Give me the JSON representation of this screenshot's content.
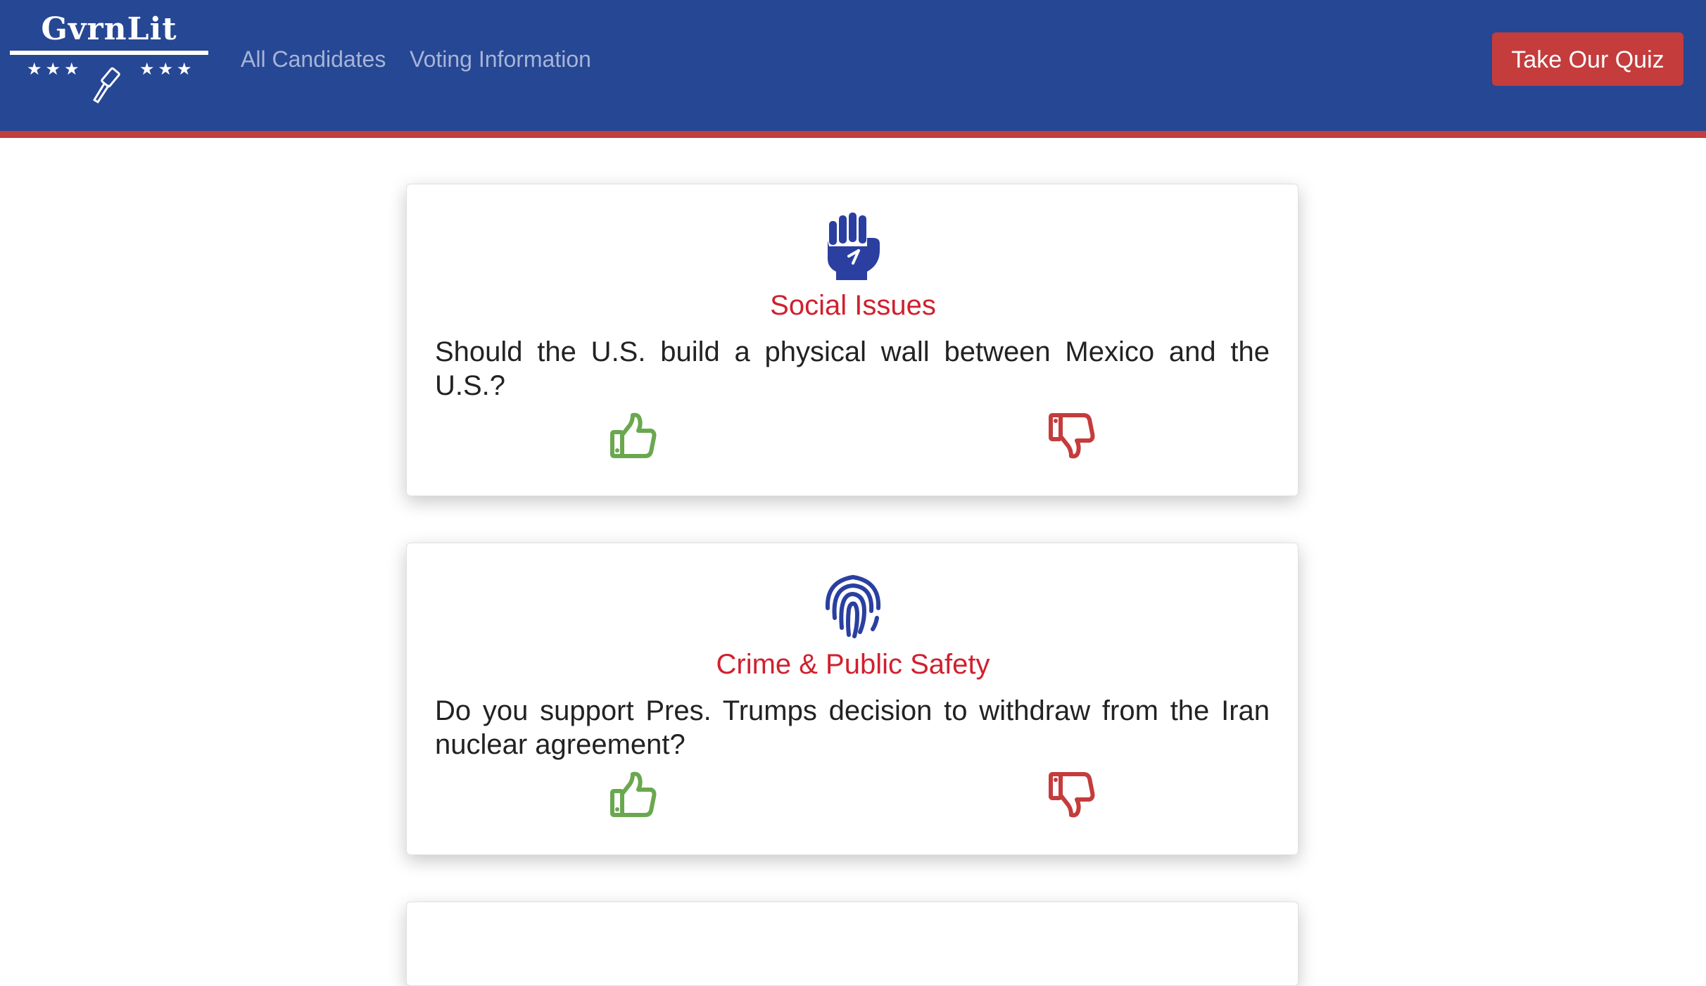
{
  "header": {
    "brand_name": "GvrnLit",
    "brand_stars_left": "★★★",
    "brand_stars_right": "★★★",
    "nav": [
      {
        "label": "All Candidates"
      },
      {
        "label": "Voting Information"
      }
    ],
    "quiz_button_label": "Take Our Quiz",
    "colors": {
      "navbar": "#264793",
      "accent": "#c43c3c",
      "nav_link": "#a6b4d8"
    }
  },
  "cards": [
    {
      "icon": "raised-fist-icon",
      "topic": "Social Issues",
      "question": "Should the U.S. build a physical wall between Mexico and the U.S.?",
      "agree_icon": "thumbs-up-icon",
      "disagree_icon": "thumbs-down-icon"
    },
    {
      "icon": "fingerprint-icon",
      "topic": "Crime & Public Safety",
      "question": "Do you support Pres. Trumps decision to withdraw from the Iran nuclear agreement?",
      "agree_icon": "thumbs-up-icon",
      "disagree_icon": "thumbs-down-icon"
    }
  ],
  "colors": {
    "topic_icon": "#2a3fa0",
    "topic_title": "#d0202f",
    "thumbs_up": "#6aa84f",
    "thumbs_down": "#c43c3c"
  }
}
